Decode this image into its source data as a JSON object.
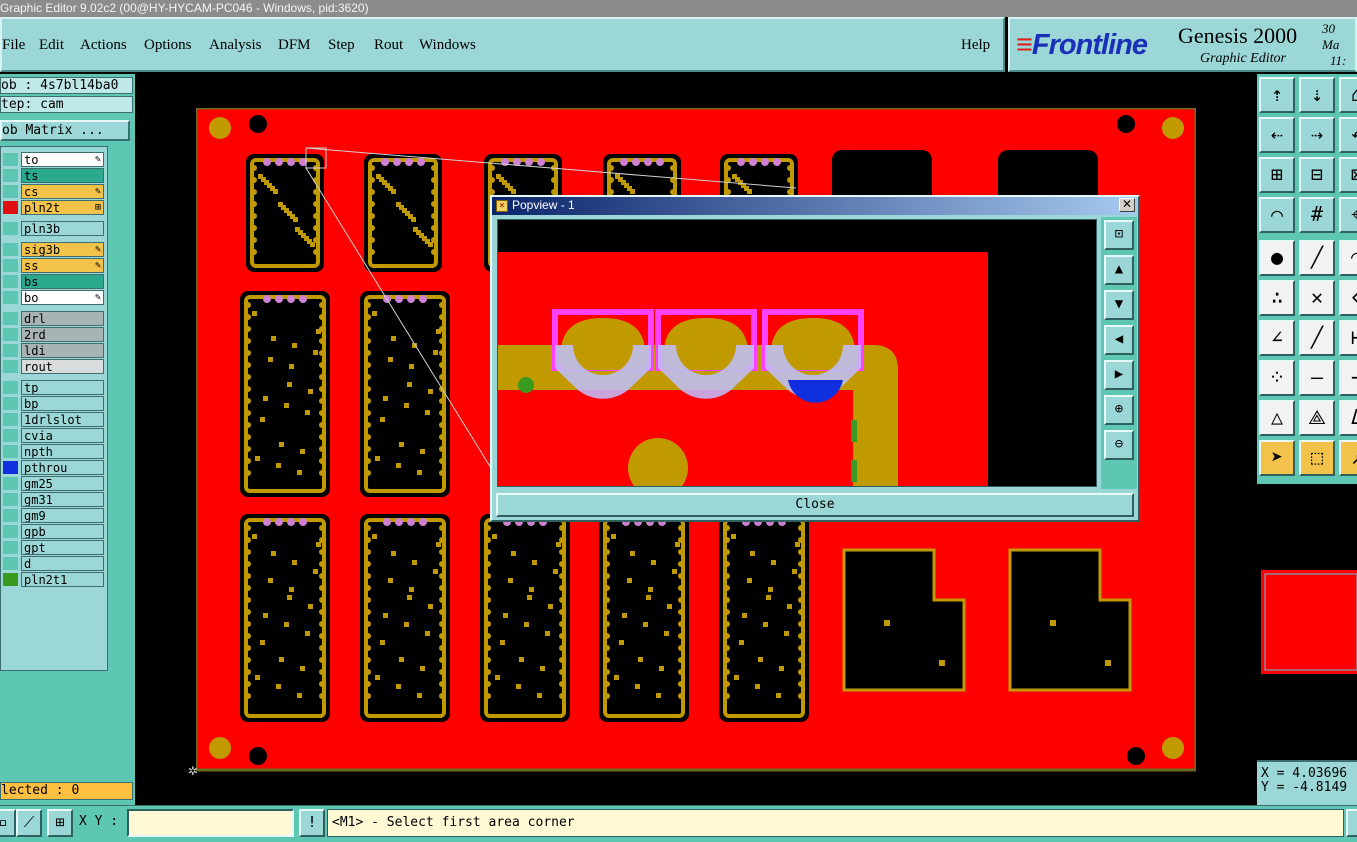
{
  "window": {
    "title": "Graphic Editor 9.02c2 (00@HY-HYCAM-PC046 - Windows, pid:3620)"
  },
  "menu": {
    "file": "File",
    "edit": "Edit",
    "actions": "Actions",
    "options": "Options",
    "analysis": "Analysis",
    "dfm": "DFM",
    "step": "Step",
    "rout": "Rout",
    "windows": "Windows",
    "help": "Help"
  },
  "brand": {
    "logo": "Frontline",
    "product": "Genesis 2000",
    "subtitle": "Graphic Editor",
    "date_line1": "30 Ma",
    "date_line2": "11:"
  },
  "job": {
    "job_line": "ob : 4s7bl14ba0",
    "step_line": "tep: cam",
    "matrix_button": "ob Matrix ..."
  },
  "layers": [
    {
      "name": "to",
      "bg": "#ffffff",
      "swatch": "#5ec7b3",
      "flag": "✎"
    },
    {
      "name": "ts",
      "bg": "#2ba98f",
      "swatch": "#5ec7b3",
      "flag": ""
    },
    {
      "name": "cs",
      "bg": "#f2c24a",
      "swatch": "#5ec7b3",
      "flag": "✎"
    },
    {
      "name": "pln2t",
      "bg": "#f2c24a",
      "swatch": "#e01010",
      "flag": "⊞"
    },
    {
      "name": "pln3b",
      "bg": "#9ad7d6",
      "swatch": "#5ec7b3",
      "flag": ""
    },
    {
      "name": "sig3b",
      "bg": "#f2c24a",
      "swatch": "#5ec7b3",
      "flag": "✎"
    },
    {
      "name": "ss",
      "bg": "#f2c24a",
      "swatch": "#5ec7b3",
      "flag": "✎"
    },
    {
      "name": "bs",
      "bg": "#2ba98f",
      "swatch": "#5ec7b3",
      "flag": ""
    },
    {
      "name": "bo",
      "bg": "#ffffff",
      "swatch": "#5ec7b3",
      "flag": "✎"
    },
    {
      "name": "drl",
      "bg": "#a8b4b4",
      "swatch": "#5ec7b3",
      "flag": ""
    },
    {
      "name": "2rd",
      "bg": "#a8b4b4",
      "swatch": "#5ec7b3",
      "flag": ""
    },
    {
      "name": "ldi",
      "bg": "#a8b4b4",
      "swatch": "#5ec7b3",
      "flag": ""
    },
    {
      "name": "rout",
      "bg": "#d8dcdc",
      "swatch": "#5ec7b3",
      "flag": ""
    },
    {
      "name": "tp",
      "bg": "#9ad7d6",
      "swatch": "#5ec7b3",
      "flag": ""
    },
    {
      "name": "bp",
      "bg": "#9ad7d6",
      "swatch": "#5ec7b3",
      "flag": ""
    },
    {
      "name": "1drlslot",
      "bg": "#9ad7d6",
      "swatch": "#5ec7b3",
      "flag": ""
    },
    {
      "name": "cvia",
      "bg": "#9ad7d6",
      "swatch": "#5ec7b3",
      "flag": ""
    },
    {
      "name": "npth",
      "bg": "#9ad7d6",
      "swatch": "#5ec7b3",
      "flag": ""
    },
    {
      "name": "pthrou",
      "bg": "#9ad7d6",
      "swatch": "#1030e0",
      "flag": ""
    },
    {
      "name": "gm25",
      "bg": "#9ad7d6",
      "swatch": "#5ec7b3",
      "flag": ""
    },
    {
      "name": "gm31",
      "bg": "#9ad7d6",
      "swatch": "#5ec7b3",
      "flag": ""
    },
    {
      "name": "gm9",
      "bg": "#9ad7d6",
      "swatch": "#5ec7b3",
      "flag": ""
    },
    {
      "name": "gpb",
      "bg": "#9ad7d6",
      "swatch": "#5ec7b3",
      "flag": ""
    },
    {
      "name": "gpt",
      "bg": "#9ad7d6",
      "swatch": "#5ec7b3",
      "flag": ""
    },
    {
      "name": "d",
      "bg": "#9ad7d6",
      "swatch": "#5ec7b3",
      "flag": ""
    },
    {
      "name": "pln2t1",
      "bg": "#9ad7d6",
      "swatch": "#3a9a20",
      "flag": ""
    }
  ],
  "selection": {
    "text": "lected : 0"
  },
  "coords": {
    "x": "X = 4.03696",
    "y": "Y = -4.8149"
  },
  "status": {
    "xy_label": "X Y :",
    "xy_value": "",
    "warn": "!",
    "prompt": "<M1> - Select first area corner"
  },
  "popview": {
    "title": "Popview - 1",
    "close_label": "Close",
    "close_x": "✕"
  },
  "colors": {
    "copper": "#ff0000",
    "pad": "#c09a00",
    "mask": "#ff40ff",
    "panel": "#9ad7d6",
    "background": "#000000"
  }
}
